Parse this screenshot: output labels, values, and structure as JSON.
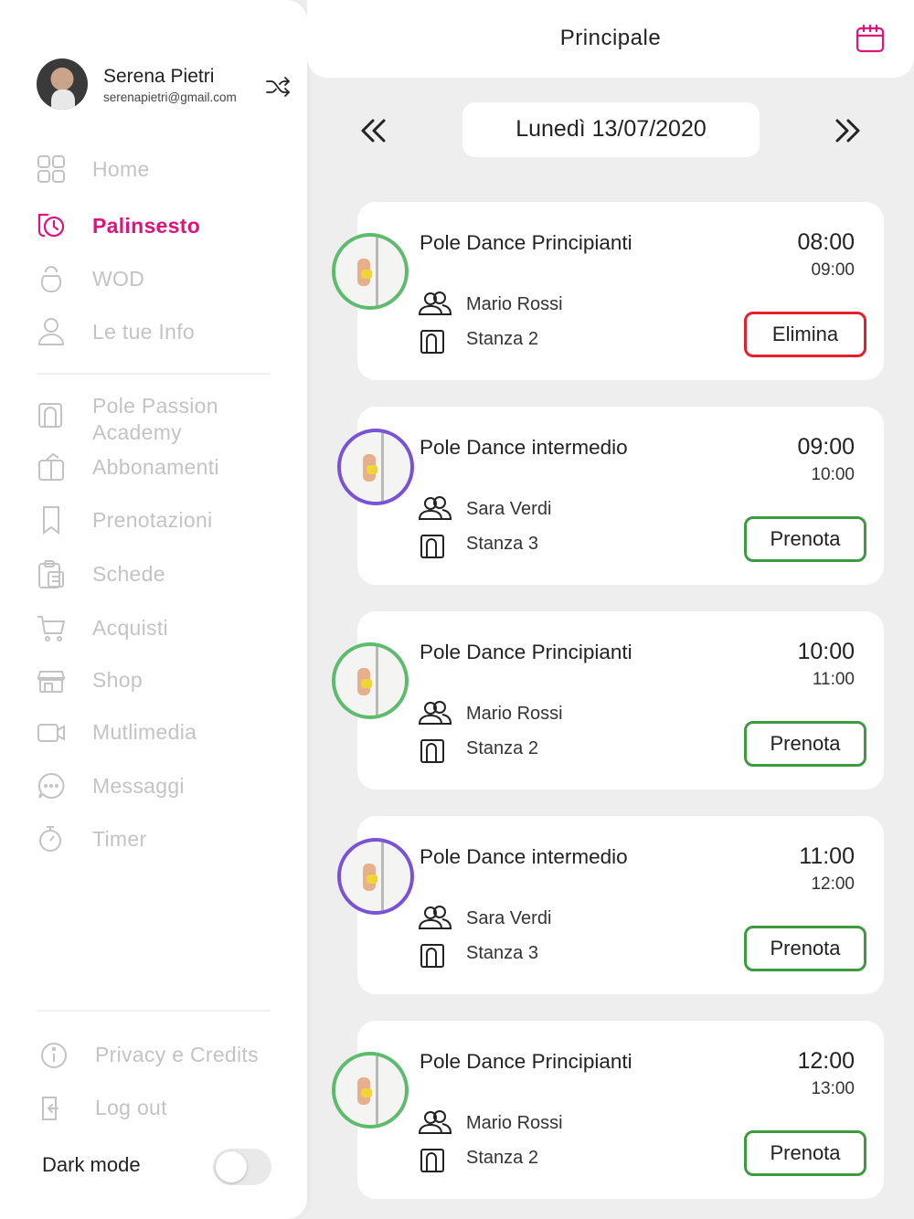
{
  "user": {
    "name": "Serena Pietri",
    "email": "serenapietri@gmail.com"
  },
  "header": {
    "title": "Principale"
  },
  "date_nav": {
    "date": "Lunedì 13/07/2020"
  },
  "nav": {
    "home": "Home",
    "palinsesto": "Palinsesto",
    "wod": "WOD",
    "info": "Le tue Info",
    "academy": "Pole Passion Academy",
    "abbonamenti": "Abbonamenti",
    "prenotazioni": "Prenotazioni",
    "schede": "Schede",
    "acquisti": "Acquisti",
    "shop": "Shop",
    "multimedia": "Mutlimedia",
    "messaggi": "Messaggi",
    "timer": "Timer",
    "privacy": "Privacy e Credits",
    "logout": "Log out"
  },
  "dark_mode": {
    "label": "Dark mode",
    "enabled": false
  },
  "colors": {
    "accent": "#e0137d",
    "book": "#3e9a3e",
    "delete": "#e4202d",
    "beginner_ring": "#5dbb6d",
    "intermediate_ring": "#7a52d6"
  },
  "classes": [
    {
      "title": "Pole Dance Principianti",
      "start": "08:00",
      "end": "09:00",
      "teacher": "Mario Rossi",
      "room": "Stanza 2",
      "action": "Elimina"
    },
    {
      "title": "Pole Dance intermedio",
      "start": "09:00",
      "end": "10:00",
      "teacher": "Sara Verdi",
      "room": "Stanza 3",
      "action": "Prenota"
    },
    {
      "title": "Pole Dance Principianti",
      "start": "10:00",
      "end": "11:00",
      "teacher": "Mario Rossi",
      "room": "Stanza 2",
      "action": "Prenota"
    },
    {
      "title": "Pole Dance intermedio",
      "start": "11:00",
      "end": "12:00",
      "teacher": "Sara Verdi",
      "room": "Stanza 3",
      "action": "Prenota"
    },
    {
      "title": "Pole Dance Principianti",
      "start": "12:00",
      "end": "13:00",
      "teacher": "Mario Rossi",
      "room": "Stanza 2",
      "action": "Prenota"
    }
  ]
}
